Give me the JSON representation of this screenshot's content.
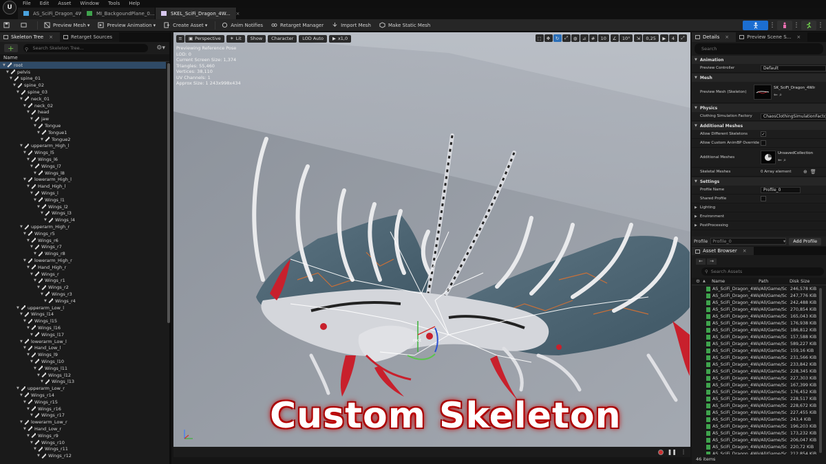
{
  "menubar": {
    "items": [
      "File",
      "Edit",
      "Asset",
      "Window",
      "Tools",
      "Help"
    ]
  },
  "tabs": [
    {
      "label": "AS_SciFi_Dragon_4Win...",
      "active": false,
      "icon_color": "#4aa3df"
    },
    {
      "label": "MI_BackgoundPlane_0...",
      "active": false,
      "icon_color": "#3fa34d",
      "modified": "*"
    },
    {
      "label": "SKEL_SciFi_Dragon_4W...",
      "active": true,
      "icon_color": "#d8c8f0"
    }
  ],
  "toolbar": {
    "buttons": [
      "Preview Mesh",
      "Preview Animation",
      "Create Asset",
      "Anim Notifies",
      "Retarget Manager",
      "Import Mesh",
      "Make Static Mesh"
    ],
    "dropdown_buttons": [
      true,
      true,
      true,
      false,
      false,
      false,
      false
    ]
  },
  "left_panel": {
    "tabs": [
      "Skeleton Tree",
      "Retarget Sources"
    ],
    "search_placeholder": "Search Skeleton Tree...",
    "column_header": "Name",
    "bones": [
      {
        "name": "root",
        "depth": 0,
        "selected": true
      },
      {
        "name": "pelvis",
        "depth": 1
      },
      {
        "name": "spine_01",
        "depth": 2
      },
      {
        "name": "spine_02",
        "depth": 3
      },
      {
        "name": "spine_03",
        "depth": 4
      },
      {
        "name": "neck_01",
        "depth": 5
      },
      {
        "name": "neck_02",
        "depth": 6
      },
      {
        "name": "head",
        "depth": 7
      },
      {
        "name": "jaw",
        "depth": 8
      },
      {
        "name": "Tongue",
        "depth": 9
      },
      {
        "name": "Tongue1",
        "depth": 10
      },
      {
        "name": "Tongue2",
        "depth": 11
      },
      {
        "name": "upperarm_High_l",
        "depth": 5
      },
      {
        "name": "Wings_l5",
        "depth": 6
      },
      {
        "name": "Wings_l6",
        "depth": 7
      },
      {
        "name": "Wings_l7",
        "depth": 8
      },
      {
        "name": "Wings_l8",
        "depth": 9
      },
      {
        "name": "lowerarm_High_l",
        "depth": 6
      },
      {
        "name": "Hand_High_l",
        "depth": 7
      },
      {
        "name": "Wings_l",
        "depth": 8
      },
      {
        "name": "Wings_l1",
        "depth": 9
      },
      {
        "name": "Wings_l2",
        "depth": 10
      },
      {
        "name": "Wings_l3",
        "depth": 11
      },
      {
        "name": "Wings_l4",
        "depth": 12
      },
      {
        "name": "upperarm_High_r",
        "depth": 5
      },
      {
        "name": "Wings_r5",
        "depth": 6
      },
      {
        "name": "Wings_r6",
        "depth": 7
      },
      {
        "name": "Wings_r7",
        "depth": 8
      },
      {
        "name": "Wings_r8",
        "depth": 9
      },
      {
        "name": "lowerarm_High_r",
        "depth": 6
      },
      {
        "name": "Hand_High_r",
        "depth": 7
      },
      {
        "name": "Wings_r",
        "depth": 8
      },
      {
        "name": "Wings_r1",
        "depth": 9
      },
      {
        "name": "Wings_r2",
        "depth": 10
      },
      {
        "name": "Wings_r3",
        "depth": 11
      },
      {
        "name": "Wings_r4",
        "depth": 12
      },
      {
        "name": "upperarm_Low_l",
        "depth": 4
      },
      {
        "name": "Wings_l14",
        "depth": 5
      },
      {
        "name": "Wings_l15",
        "depth": 6
      },
      {
        "name": "Wings_l16",
        "depth": 7
      },
      {
        "name": "Wings_l17",
        "depth": 8
      },
      {
        "name": "lowerarm_Low_l",
        "depth": 5
      },
      {
        "name": "Hand_Low_l",
        "depth": 6
      },
      {
        "name": "Wings_l9",
        "depth": 7
      },
      {
        "name": "Wings_l10",
        "depth": 8
      },
      {
        "name": "Wings_l11",
        "depth": 9
      },
      {
        "name": "Wings_l12",
        "depth": 10
      },
      {
        "name": "Wings_l13",
        "depth": 11
      },
      {
        "name": "upperarm_Low_r",
        "depth": 4
      },
      {
        "name": "Wings_r14",
        "depth": 5
      },
      {
        "name": "Wings_r15",
        "depth": 6
      },
      {
        "name": "Wings_r16",
        "depth": 7
      },
      {
        "name": "Wings_r17",
        "depth": 8
      },
      {
        "name": "lowerarm_Low_r",
        "depth": 5
      },
      {
        "name": "Hand_Low_r",
        "depth": 6
      },
      {
        "name": "Wings_r9",
        "depth": 7
      },
      {
        "name": "Wings_r10",
        "depth": 8
      },
      {
        "name": "Wings_r11",
        "depth": 9
      },
      {
        "name": "Wings_r12",
        "depth": 10
      }
    ]
  },
  "viewport": {
    "buttons": [
      "Perspective",
      "Lit",
      "Show",
      "Character",
      "LOD Auto"
    ],
    "play_rate": "x1,0",
    "right_values": [
      "10",
      "10°",
      "0,25",
      "4"
    ],
    "info_lines": [
      "Previewing Reference Pose",
      "LOD: 0",
      "Current Screen Size: 1,374",
      "Triangles: 55,460",
      "Vertices: 38,110",
      "UV Channels: 1",
      "Approx Size: 1 243x998x434"
    ],
    "overlay_title": "Custom Skeleton",
    "root_label": "root"
  },
  "details": {
    "tabs": [
      "Details",
      "Preview Scene S..."
    ],
    "search_placeholder": "Search",
    "sections": {
      "animation": "Animation",
      "preview_controller_label": "Preview Controller",
      "preview_controller_value": "Default",
      "mesh": "Mesh",
      "preview_mesh_label": "Preview Mesh (Skeleton)",
      "preview_mesh_value": "SK_SciFi_Dragon_4Wings",
      "physics": "Physics",
      "clothing_label": "Clothing Simulation Factory",
      "clothing_value": "ChaosClothingSimulationFactory",
      "additional_meshes": "Additional Meshes",
      "allow_diff_label": "Allow Different Skeletons",
      "allow_custom_label": "Allow Custom AnimBP Override",
      "add_meshes_label": "Additional Meshes",
      "add_meshes_value": "UnsavedCollection",
      "skeletal_meshes_label": "Skeletal Meshes",
      "skeletal_meshes_value": "0 Array element",
      "settings": "Settings",
      "profile_name_label": "Profile Name",
      "profile_name_value": "Profile_0",
      "shared_profile_label": "Shared Profile",
      "lighting": "Lighting",
      "environment": "Environment",
      "postprocessing": "PostProcessing"
    }
  },
  "profile_bar": {
    "label": "Profile",
    "value": "Profile_0",
    "add_button": "Add Profile"
  },
  "asset_browser": {
    "tab": "Asset Browser",
    "search_placeholder": "Search Assets",
    "columns": [
      "Name",
      "Path",
      "Disk Size"
    ],
    "rows": [
      {
        "name": "AS_SciFi_Dragon_4Win",
        "path": "/All/Game/Sc",
        "size": "246,578 KiB"
      },
      {
        "name": "AS_SciFi_Dragon_4Win",
        "path": "/All/Game/Sc",
        "size": "247,776 KiB"
      },
      {
        "name": "AS_SciFi_Dragon_4Win",
        "path": "/All/Game/Sc",
        "size": "242,488 KiB"
      },
      {
        "name": "AS_SciFi_Dragon_4Win",
        "path": "/All/Game/Sc",
        "size": "270,854 KiB"
      },
      {
        "name": "AS_SciFi_Dragon_4Win",
        "path": "/All/Game/Sc",
        "size": "165,043 KiB"
      },
      {
        "name": "AS_SciFi_Dragon_4Win",
        "path": "/All/Game/Sc",
        "size": "176,938 KiB"
      },
      {
        "name": "AS_SciFi_Dragon_4Win",
        "path": "/All/Game/Sc",
        "size": "186,812 KiB"
      },
      {
        "name": "AS_SciFi_Dragon_4Win",
        "path": "/All/Game/Sc",
        "size": "157,588 KiB"
      },
      {
        "name": "AS_SciFi_Dragon_4Win",
        "path": "/All/Game/Sc",
        "size": "589,227 KiB"
      },
      {
        "name": "AS_SciFi_Dragon_4Win",
        "path": "/All/Game/Sc",
        "size": "159,16 KiB"
      },
      {
        "name": "AS_SciFi_Dragon_4Win",
        "path": "/All/Game/Sc",
        "size": "231,566 KiB"
      },
      {
        "name": "AS_SciFi_Dragon_4Win",
        "path": "/All/Game/Sc",
        "size": "233,842 KiB"
      },
      {
        "name": "AS_SciFi_Dragon_4Win",
        "path": "/All/Game/Sc",
        "size": "228,345 KiB"
      },
      {
        "name": "AS_SciFi_Dragon_4Win",
        "path": "/All/Game/Sc",
        "size": "227,303 KiB"
      },
      {
        "name": "AS_SciFi_Dragon_4Win",
        "path": "/All/Game/Sc",
        "size": "167,399 KiB"
      },
      {
        "name": "AS_SciFi_Dragon_4Win",
        "path": "/All/Game/Sc",
        "size": "176,452 KiB"
      },
      {
        "name": "AS_SciFi_Dragon_4Win",
        "path": "/All/Game/Sc",
        "size": "228,517 KiB"
      },
      {
        "name": "AS_SciFi_Dragon_4Win",
        "path": "/All/Game/Sc",
        "size": "228,672 KiB"
      },
      {
        "name": "AS_SciFi_Dragon_4Win",
        "path": "/All/Game/Sc",
        "size": "227,455 KiB"
      },
      {
        "name": "AS_SciFi_Dragon_4Win",
        "path": "/All/Game/Sc",
        "size": "243,4 KiB"
      },
      {
        "name": "AS_SciFi_Dragon_4Win",
        "path": "/All/Game/Sc",
        "size": "196,203 KiB"
      },
      {
        "name": "AS_SciFi_Dragon_4Win",
        "path": "/All/Game/Sc",
        "size": "173,232 KiB"
      },
      {
        "name": "AS_SciFi_Dragon_4Win",
        "path": "/All/Game/Sc",
        "size": "206,047 KiB"
      },
      {
        "name": "AS_SciFi_Dragon_4Win",
        "path": "/All/Game/Sc",
        "size": "220,72 KiB"
      },
      {
        "name": "AS_SciFi_Dragon_4Win",
        "path": "/All/Game/Sc",
        "size": "212,854 KiB"
      },
      {
        "name": "AS_SciFi_Dragon_4Win",
        "path": "/All/Game/Sc",
        "size": "184,759 KiB"
      },
      {
        "name": "AS_SciFi_Dragon_4Win",
        "path": "/All/Game/Sc",
        "size": "198,848 KiB"
      },
      {
        "name": "AS_SciFi_Dragon_4Win",
        "path": "/All/Game/Sc",
        "size": "233,239 KiB"
      },
      {
        "name": "AS_SciFi_Dragon_4Win",
        "path": "/All/Game/Sc",
        "size": "388,157 KiB"
      }
    ],
    "item_count": "46 items"
  }
}
